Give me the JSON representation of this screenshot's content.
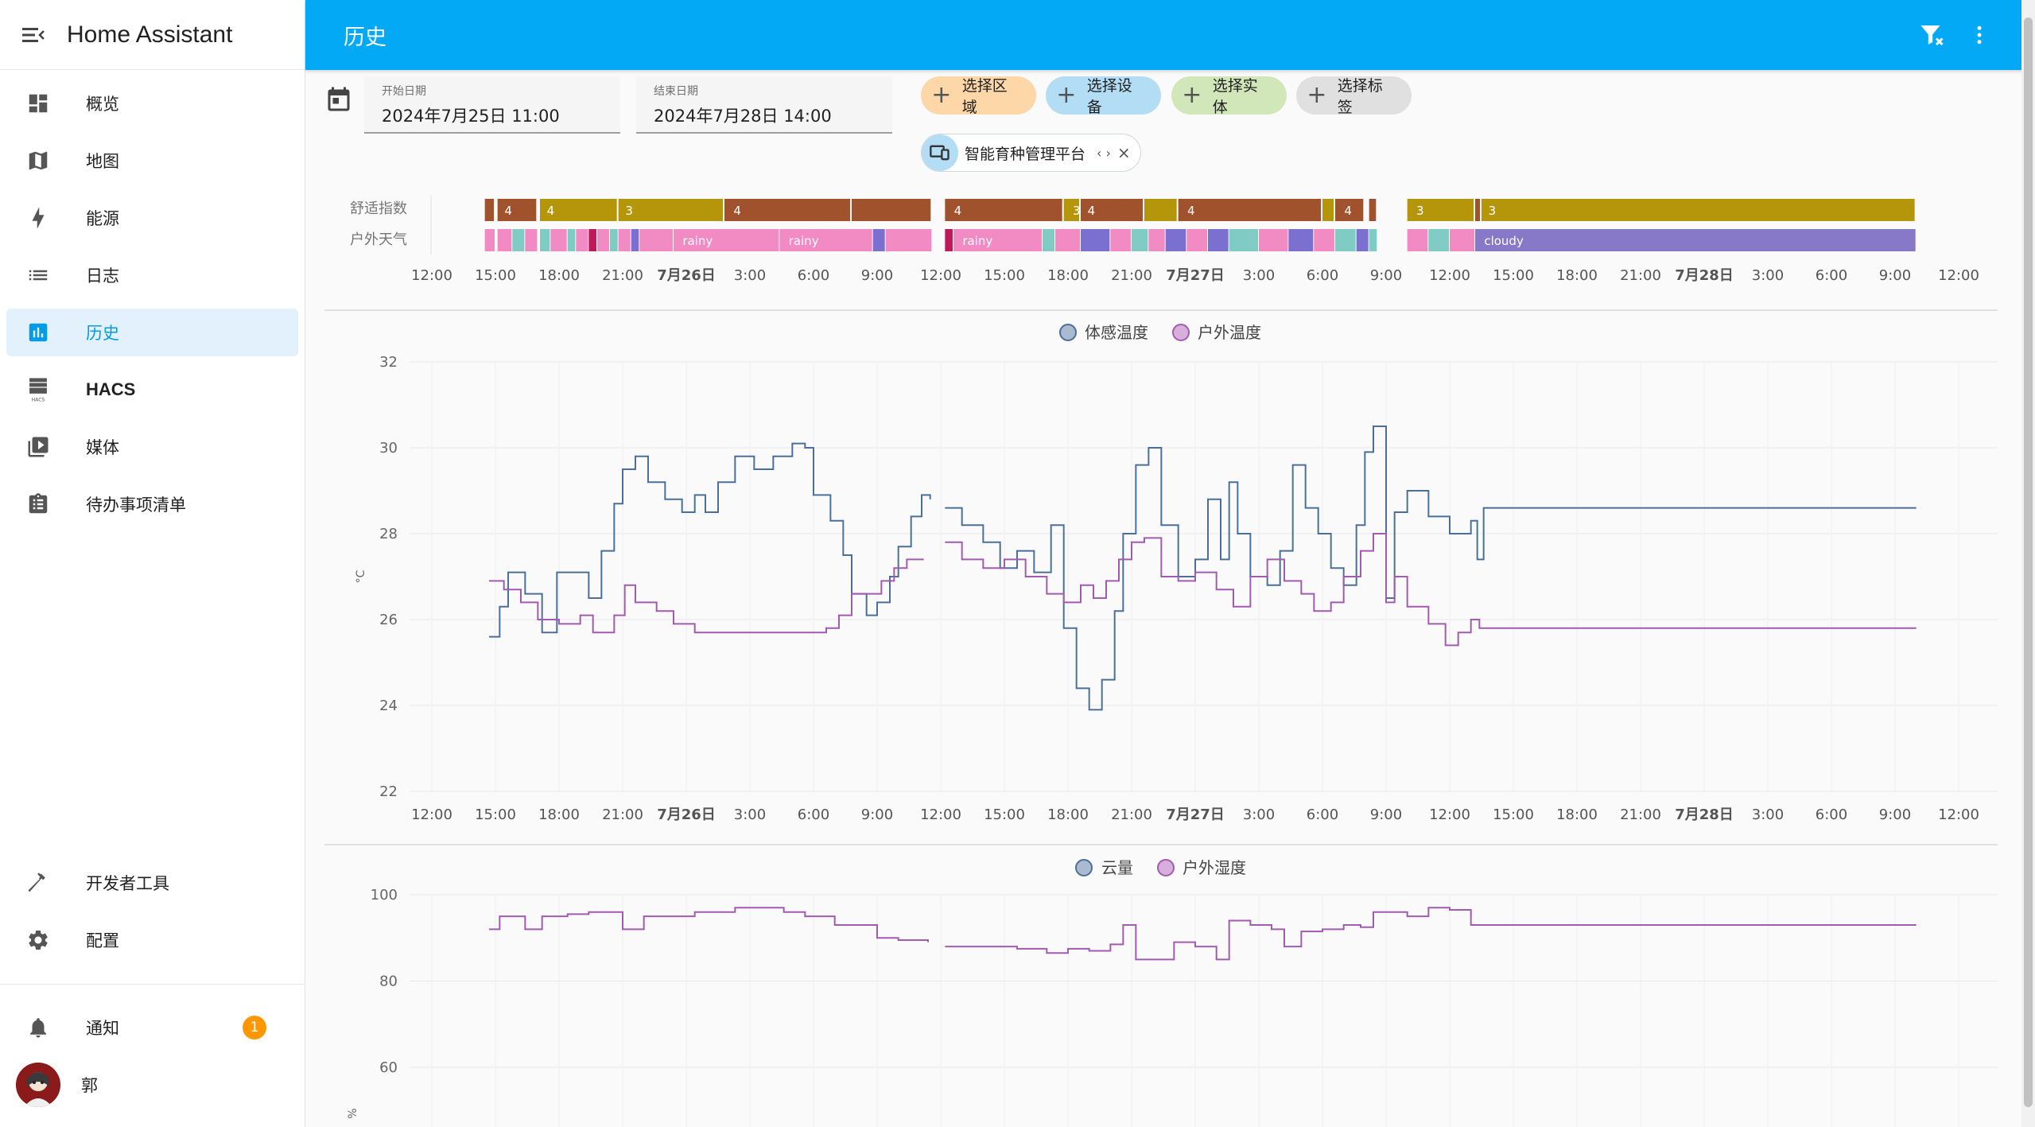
{
  "app": {
    "title": "Home Assistant"
  },
  "header": {
    "title": "历史"
  },
  "sidebar": {
    "items": [
      {
        "label": "概览",
        "icon": "dashboard-icon"
      },
      {
        "label": "地图",
        "icon": "map-icon"
      },
      {
        "label": "能源",
        "icon": "lightning-icon"
      },
      {
        "label": "日志",
        "icon": "list-icon"
      },
      {
        "label": "历史",
        "icon": "chart-box-icon",
        "active": true
      },
      {
        "label": "HACS",
        "icon": "hacs-icon"
      },
      {
        "label": "媒体",
        "icon": "play-box-icon"
      },
      {
        "label": "待办事项清单",
        "icon": "clipboard-list-icon"
      }
    ],
    "bottom": [
      {
        "label": "开发者工具",
        "icon": "hammer-icon"
      },
      {
        "label": "配置",
        "icon": "gear-icon"
      }
    ],
    "notifications": {
      "label": "通知",
      "count": "1"
    },
    "user": {
      "name": "郭"
    }
  },
  "filters": {
    "start": {
      "label": "开始日期",
      "value": "2024年7月25日 11:00"
    },
    "end": {
      "label": "结束日期",
      "value": "2024年7月28日 14:00"
    },
    "chips": [
      {
        "label": "选择区域",
        "color": "#fdd7a8"
      },
      {
        "label": "选择设备",
        "color": "#b3dcf5"
      },
      {
        "label": "选择实体",
        "color": "#d2e7b9"
      },
      {
        "label": "选择标签",
        "color": "#e0e0e0"
      }
    ],
    "device": {
      "name": "智能育种管理平台",
      "expand": "‹ ›",
      "close": "×"
    }
  },
  "time_axis": [
    "12:00",
    "15:00",
    "18:00",
    "21:00",
    "7月26日",
    "3:00",
    "6:00",
    "9:00",
    "12:00",
    "15:00",
    "18:00",
    "21:00",
    "7月27日",
    "3:00",
    "6:00",
    "9:00",
    "12:00",
    "15:00",
    "18:00",
    "21:00",
    "7月28日",
    "3:00",
    "6:00",
    "9:00",
    "12:00"
  ],
  "timeline": {
    "rows": [
      {
        "name": "舒适指数",
        "labels": [
          "4",
          "4",
          "3",
          "4",
          "4",
          "3",
          "4",
          "4",
          "4",
          "3",
          "3"
        ]
      },
      {
        "name": "户外天气",
        "labels": [
          "rainy",
          "rainy",
          "rainy",
          "cloudy"
        ]
      }
    ],
    "colors": {
      "4": "#a0522d",
      "3": "#b5960a",
      "rainy": "#f28ac4",
      "cloudy": "#8878c8",
      "mix1": "#80cbc4",
      "mix2": "#7b6fd0",
      "mix3": "#c2185b"
    }
  },
  "chart_data": [
    {
      "type": "line",
      "step": true,
      "legend": [
        "体感温度",
        "户外温度"
      ],
      "ylabel": "°C",
      "ylim": [
        22,
        32
      ],
      "yticks": [
        "32",
        "30",
        "28",
        "26",
        "24",
        "22"
      ],
      "x_start": "2024-07-25 11:00",
      "x_end": "2024-07-28 14:00",
      "series": [
        {
          "name": "体感温度",
          "color": "#4a6f9a",
          "points": [
            [
              3.7,
              25.6
            ],
            [
              4.2,
              26.3
            ],
            [
              4.6,
              27.1
            ],
            [
              5.4,
              26.6
            ],
            [
              6.2,
              25.7
            ],
            [
              6.9,
              27.1
            ],
            [
              8.4,
              26.5
            ],
            [
              9.0,
              27.6
            ],
            [
              9.6,
              28.7
            ],
            [
              10.0,
              29.5
            ],
            [
              10.6,
              29.8
            ],
            [
              11.2,
              29.2
            ],
            [
              12.0,
              28.8
            ],
            [
              12.8,
              28.5
            ],
            [
              13.4,
              28.9
            ],
            [
              13.9,
              28.5
            ],
            [
              14.5,
              29.2
            ],
            [
              15.3,
              29.8
            ],
            [
              16.2,
              29.5
            ],
            [
              17.1,
              29.8
            ],
            [
              18.0,
              30.1
            ],
            [
              18.6,
              30.0
            ],
            [
              19.0,
              28.9
            ],
            [
              19.8,
              28.3
            ],
            [
              20.4,
              27.5
            ],
            [
              20.8,
              26.6
            ],
            [
              21.5,
              26.1
            ],
            [
              22.0,
              26.4
            ],
            [
              22.6,
              27.0
            ],
            [
              23.0,
              27.7
            ],
            [
              23.6,
              28.4
            ],
            [
              24.1,
              28.9
            ],
            [
              24.5,
              28.8
            ]
          ]
        },
        {
          "name": "户外温度",
          "color": "#a25bb0",
          "points": [
            [
              3.7,
              26.9
            ],
            [
              4.4,
              26.7
            ],
            [
              5.2,
              26.4
            ],
            [
              6.0,
              26.0
            ],
            [
              7.0,
              25.9
            ],
            [
              8.0,
              26.1
            ],
            [
              8.6,
              25.7
            ],
            [
              9.6,
              26.1
            ],
            [
              10.1,
              26.8
            ],
            [
              10.6,
              26.4
            ],
            [
              11.6,
              26.2
            ],
            [
              12.4,
              25.9
            ],
            [
              13.4,
              25.7
            ],
            [
              14.4,
              25.7
            ],
            [
              15.5,
              25.7
            ],
            [
              16.6,
              25.7
            ],
            [
              17.6,
              25.7
            ],
            [
              18.6,
              25.7
            ],
            [
              19.6,
              25.8
            ],
            [
              20.2,
              26.1
            ],
            [
              20.8,
              26.6
            ],
            [
              21.6,
              26.6
            ],
            [
              22.2,
              26.9
            ],
            [
              22.8,
              27.2
            ],
            [
              23.4,
              27.4
            ],
            [
              24.2,
              27.4
            ]
          ]
        }
      ]
    },
    {
      "type": "line",
      "step": true,
      "legend": [
        "云量",
        "户外湿度"
      ],
      "ylabel": "%",
      "yticks": [
        "100",
        "80",
        "60"
      ],
      "series": [
        {
          "name": "户外湿度",
          "color": "#a25bb0",
          "points": [
            [
              3.7,
              92
            ],
            [
              4.2,
              95
            ],
            [
              5.4,
              92
            ],
            [
              6.2,
              95
            ],
            [
              7.4,
              95.5
            ],
            [
              8.4,
              96
            ],
            [
              10.0,
              92
            ],
            [
              11.0,
              95
            ],
            [
              13.4,
              96
            ],
            [
              15.3,
              97
            ],
            [
              17.6,
              96
            ],
            [
              18.6,
              95
            ],
            [
              20.0,
              93
            ],
            [
              22.0,
              90
            ],
            [
              23.0,
              89.5
            ],
            [
              24.4,
              89
            ]
          ]
        }
      ]
    }
  ]
}
